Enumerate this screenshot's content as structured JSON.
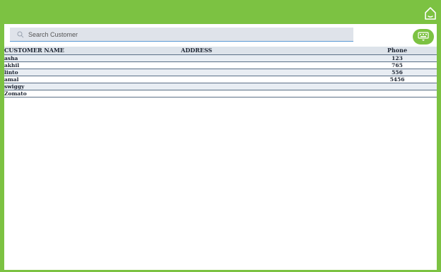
{
  "header": {
    "home_icon": "home-icon"
  },
  "search": {
    "placeholder": "Search Customer",
    "value": ""
  },
  "keyboard_button": {
    "icon": "keyboard-icon"
  },
  "table": {
    "columns": {
      "name": "CUSTOMER NAME",
      "address": "ADDRESS",
      "phone": "Phone"
    },
    "rows": [
      {
        "name": "asha",
        "address": "",
        "phone": "123"
      },
      {
        "name": "akhil",
        "address": "",
        "phone": "765"
      },
      {
        "name": "linto",
        "address": "",
        "phone": "556"
      },
      {
        "name": "amal",
        "address": "",
        "phone": "5456"
      },
      {
        "name": "swiggy",
        "address": "",
        "phone": ""
      },
      {
        "name": "Zomato",
        "address": "",
        "phone": ""
      }
    ]
  },
  "colors": {
    "accent": "#7cc242",
    "row_alt": "#e8edf3",
    "border": "#5a6f86"
  }
}
